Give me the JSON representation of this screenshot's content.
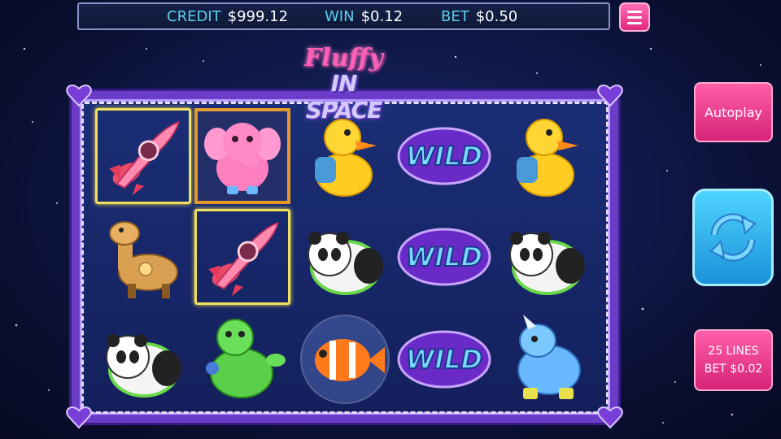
{
  "header": {
    "credit_label": "CREDIT",
    "credit_value": "$999.12",
    "win_label": "WIN",
    "win_value": "$0.12",
    "bet_label": "BET",
    "bet_value": "$0.50"
  },
  "logo": {
    "line1": "Fluffy",
    "line2": "IN SPACE"
  },
  "reels": {
    "row1": [
      "rocket",
      "elephant",
      "duck",
      "wild",
      "duck"
    ],
    "row2": [
      "giraffe",
      "rocket",
      "panda",
      "wild",
      "panda"
    ],
    "row3": [
      "panda",
      "turtle",
      "clownfish",
      "wild",
      "rhino"
    ],
    "wild_label": "WILD",
    "winning_cells": [
      "row1.col1",
      "row1.col2",
      "row2.col2"
    ]
  },
  "controls": {
    "autoplay_label": "Autoplay",
    "lines_label": "25 LINES",
    "bet_per_line_label": "BET $0.02",
    "spin_icon": "refresh-icon",
    "menu_icon": "hamburger-menu-icon"
  },
  "colors": {
    "accent_pink": "#e0267e",
    "accent_cyan": "#5ad0ee",
    "frame_purple": "#6a3cc8",
    "win_highlight": "#f0e060"
  }
}
